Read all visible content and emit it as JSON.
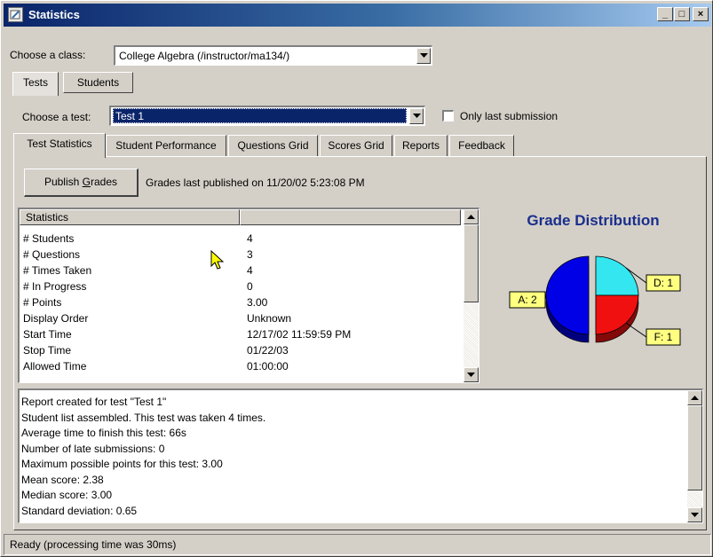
{
  "window": {
    "title": "Statistics",
    "minimize": "_",
    "maximize": "□",
    "close": "×"
  },
  "class_select": {
    "label": "Choose a class:",
    "value": "College Algebra (/instructor/ma134/)"
  },
  "view_tabs": [
    {
      "label": "Tests"
    },
    {
      "label": "Students"
    }
  ],
  "test_select": {
    "label": "Choose a test:",
    "value": "Test 1"
  },
  "only_last_submission": {
    "label": "Only last submission",
    "checked": false
  },
  "tabs": [
    {
      "label": "Test Statistics"
    },
    {
      "label": "Student Performance"
    },
    {
      "label": "Questions Grid"
    },
    {
      "label": "Scores Grid"
    },
    {
      "label": "Reports"
    },
    {
      "label": "Feedback"
    }
  ],
  "publish": {
    "button_prefix": "Publish ",
    "button_mnemonic": "G",
    "button_suffix": "rades",
    "status": "Grades last published on 11/20/02 5:23:08 PM"
  },
  "stats_table": {
    "header": "Statistics",
    "header2": "",
    "rows": [
      {
        "key": "# Students",
        "value": "4"
      },
      {
        "key": "# Questions",
        "value": "3"
      },
      {
        "key": "# Times Taken",
        "value": "4"
      },
      {
        "key": "# In Progress",
        "value": "0"
      },
      {
        "key": "# Points",
        "value": "3.00"
      },
      {
        "key": "Display Order",
        "value": "Unknown"
      },
      {
        "key": "Start Time",
        "value": "12/17/02 11:59:59 PM"
      },
      {
        "key": "Stop Time",
        "value": "01/22/03"
      },
      {
        "key": "Allowed Time",
        "value": "01:00:00"
      }
    ]
  },
  "chart_data": {
    "type": "pie",
    "title": "Grade Distribution",
    "slices": [
      {
        "label": "A: 2",
        "value": 2,
        "color": "#0000e6"
      },
      {
        "label": "D: 1",
        "value": 1,
        "color": "#33e6f0"
      },
      {
        "label": "F: 1",
        "value": 1,
        "color": "#f01010"
      }
    ],
    "label_background": "#ffff80",
    "title_color": "#1a2e8c"
  },
  "report_lines": [
    "Report created for test \"Test 1\"",
    "Student list assembled. This test was taken 4 times.",
    "Average time to finish this test: 66s",
    "Number of late submissions: 0",
    "Maximum possible points for this test: 3.00",
    "Mean score: 2.38",
    "Median score: 3.00",
    "Standard deviation: 0.65"
  ],
  "statusbar": {
    "text": "Ready (processing time was 30ms)"
  },
  "colors": {
    "selection": "#0a246a",
    "face": "#d4d0c8"
  }
}
